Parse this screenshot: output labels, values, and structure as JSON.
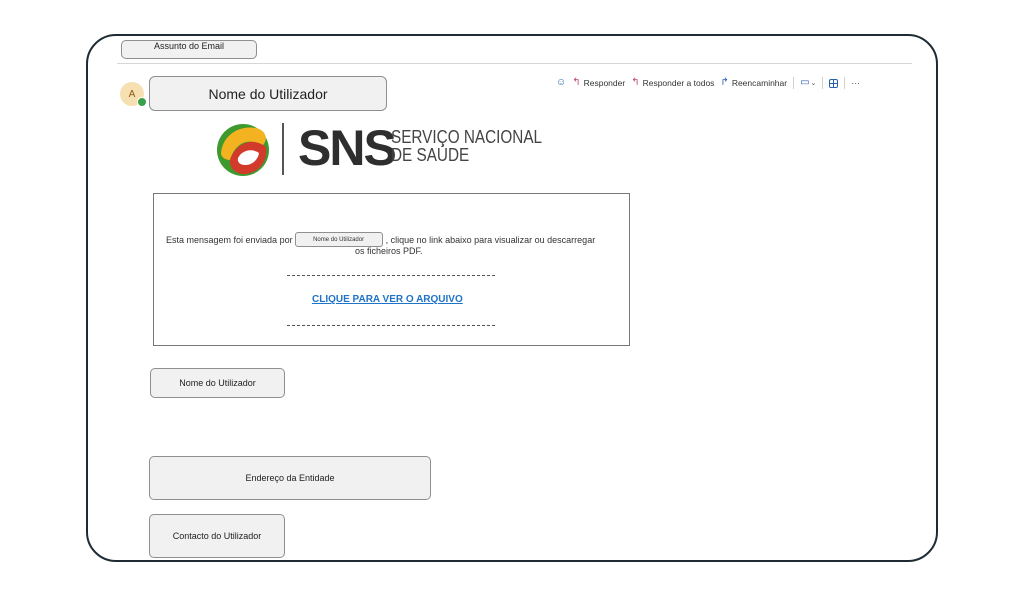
{
  "email": {
    "subject_placeholder": "Assunto do Email",
    "sender_avatar_initial": "A",
    "sender_name_placeholder": "Nome do Utilizador"
  },
  "toolbar": {
    "reply_label": "Responder",
    "reply_all_label": "Responder a todos",
    "forward_label": "Reencaminhar",
    "more_label": "···"
  },
  "logo": {
    "brand": "SNS",
    "subtitle_line1": "SERVIÇO NACIONAL",
    "subtitle_line2": "DE SAÚDE",
    "colors": {
      "green": "#3e9a2e",
      "yellow": "#f3b21f",
      "red": "#d23a2b",
      "text": "#2e2e2e"
    }
  },
  "message": {
    "text_before": "Esta mensagem foi enviada por",
    "inline_sender": "Nome do Utilizador",
    "text_after": ", clique no link abaixo para visualizar ou descarregar",
    "text_line2": "os ficheiros PDF.",
    "link_label": "CLIQUE PARA VER O ARQUIVO",
    "link_color": "#1f73c8"
  },
  "signature": {
    "name": "Nome do Utilizador",
    "address": "Endereço da Entidade",
    "contact": "Contacto do Utilizador"
  }
}
